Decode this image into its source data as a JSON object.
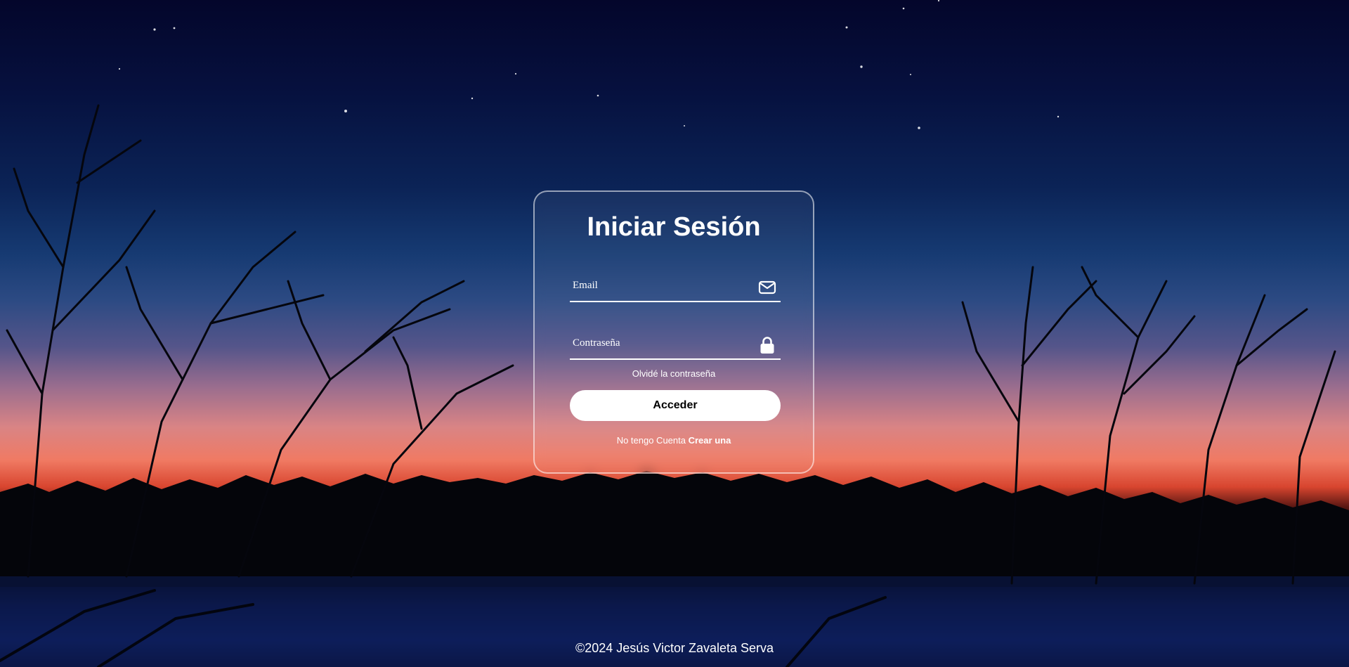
{
  "login": {
    "title": "Iniciar Sesión",
    "email_placeholder": "Email",
    "password_placeholder": "Contraseña",
    "forgot_label": "Olvidé la contraseña",
    "submit_label": "Acceder",
    "register_prompt": "No tengo Cuenta",
    "register_link": "Crear una"
  },
  "footer": {
    "copyright": "©2024 Jesús Victor Zavaleta Serva"
  },
  "icons": {
    "email": "envelope-icon",
    "password": "lock-icon"
  },
  "colors": {
    "text": "#ffffff",
    "button_bg": "#ffffff",
    "button_text": "#000000"
  }
}
